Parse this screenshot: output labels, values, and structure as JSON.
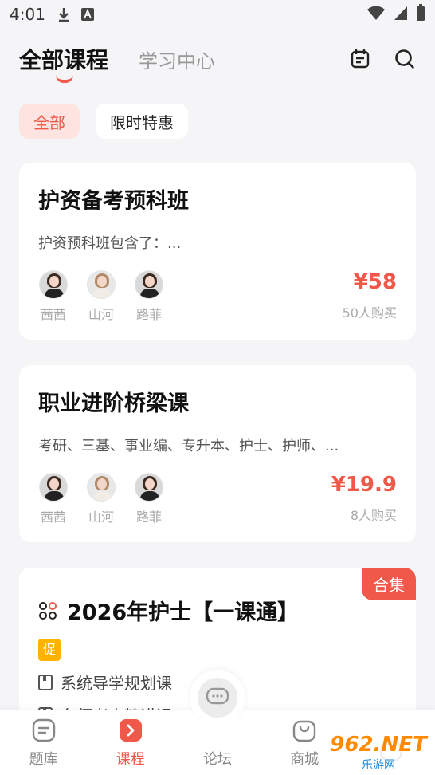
{
  "status_bar": {
    "time": "4:01",
    "icons": [
      "download-icon",
      "app-a-icon",
      "wifi-icon",
      "signal-icon",
      "battery-icon"
    ]
  },
  "header": {
    "active_tab": "全部课程",
    "inactive_tab": "学习中心",
    "accent_color": "#f0584a"
  },
  "filters": {
    "all": "全部",
    "limited": "限时特惠"
  },
  "courses": [
    {
      "title": "护资备考预科班",
      "desc": "护资预科班包含了：...",
      "teachers": [
        "茜茜",
        "山河",
        "路菲"
      ],
      "price": "¥58",
      "buyers": "50人购买"
    },
    {
      "title": "职业进阶桥梁课",
      "desc": "考研、三基、事业编、专升本、护士、护师、...",
      "teachers": [
        "茜茜",
        "山河",
        "路菲"
      ],
      "price": "¥19.9",
      "buyers": "8人购买"
    },
    {
      "badge": "合集",
      "title": "2026年护士【一课通】",
      "promo": "促",
      "features": [
        "系统导学规划课",
        "名师考点精讲课"
      ]
    }
  ],
  "bottom_nav": {
    "items": [
      "题库",
      "课程",
      "论坛",
      "商城"
    ],
    "active": "课程"
  },
  "watermark": {
    "main": "962.NET",
    "sub": "乐游网"
  }
}
